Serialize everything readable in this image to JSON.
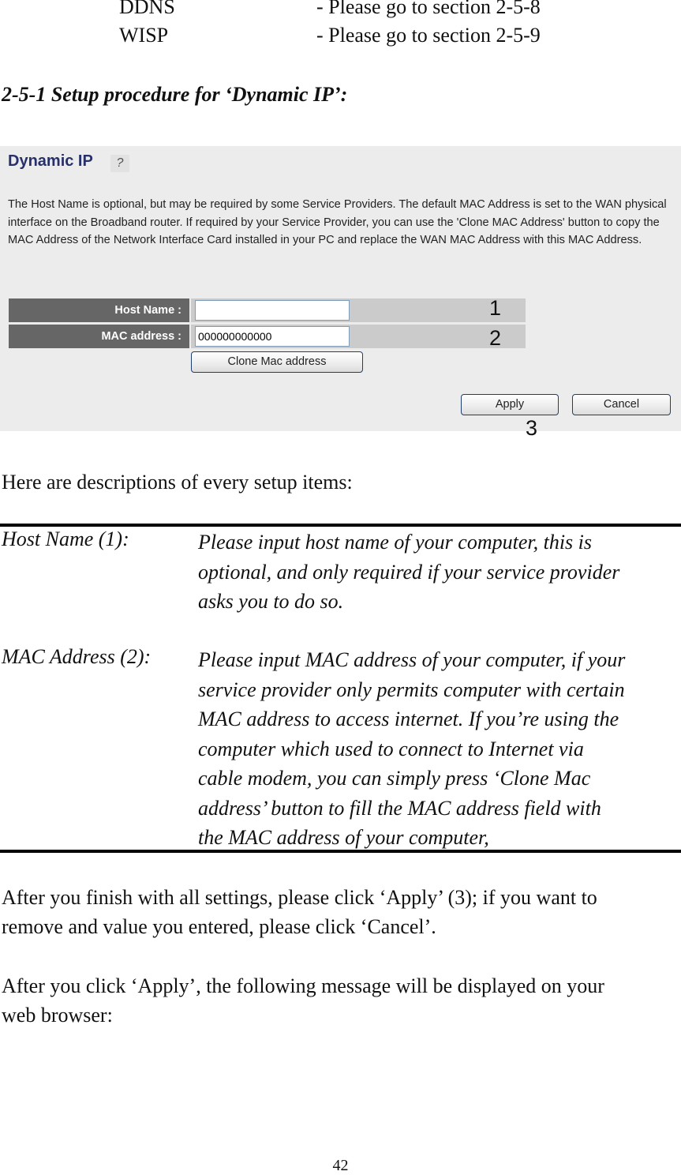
{
  "section_list": [
    {
      "name": "DDNS",
      "ref": "- Please go to section 2-5-8"
    },
    {
      "name": "WISP",
      "ref": "- Please go to section 2-5-9"
    }
  ],
  "section_heading": "2-5-1 Setup procedure for ‘Dynamic IP’:",
  "screenshot": {
    "title": "Dynamic IP",
    "help_icon": "help-icon",
    "description": "The Host Name is optional, but may be required by some Service Providers. The default MAC Address is set to the WAN physical interface on the Broadband router. If required by your Service Provider, you can use the 'Clone MAC Address' button to copy the MAC Address of the Network Interface Card installed in your PC and replace the WAN MAC Address with this MAC Address.",
    "fields": [
      {
        "label": "Host Name :",
        "value": "",
        "callout": "1"
      },
      {
        "label": "MAC address :",
        "value": "000000000000",
        "callout": "2"
      }
    ],
    "clone_button": "Clone Mac address",
    "apply_button": "Apply",
    "cancel_button": "Cancel",
    "apply_callout": "3"
  },
  "intro": "Here are descriptions of every setup items:",
  "descriptions": [
    {
      "term": "Host Name (1):",
      "lines": [
        "Please input host name of your computer, this is",
        "optional, and only required if your service provider",
        "asks you to do so."
      ]
    },
    {
      "term": "MAC Address (2):",
      "lines": [
        "Please input MAC address of your computer, if your",
        "service provider only permits computer with certain",
        "MAC address to access internet. If you’re using the",
        "computer which used to connect to Internet via",
        "cable modem, you can simply press ‘Clone Mac",
        "address’ button to fill the MAC address field with",
        "the MAC address of your computer,"
      ]
    }
  ],
  "paragraphs": [
    {
      "lines": [
        "After you finish with all settings, please click ‘Apply’ (3); if you want to",
        "remove and value you entered, please click ‘Cancel’."
      ]
    },
    {
      "lines": [
        "After you click ‘Apply’, the following message will be displayed on your",
        "web browser:"
      ]
    }
  ],
  "page_number": "42"
}
